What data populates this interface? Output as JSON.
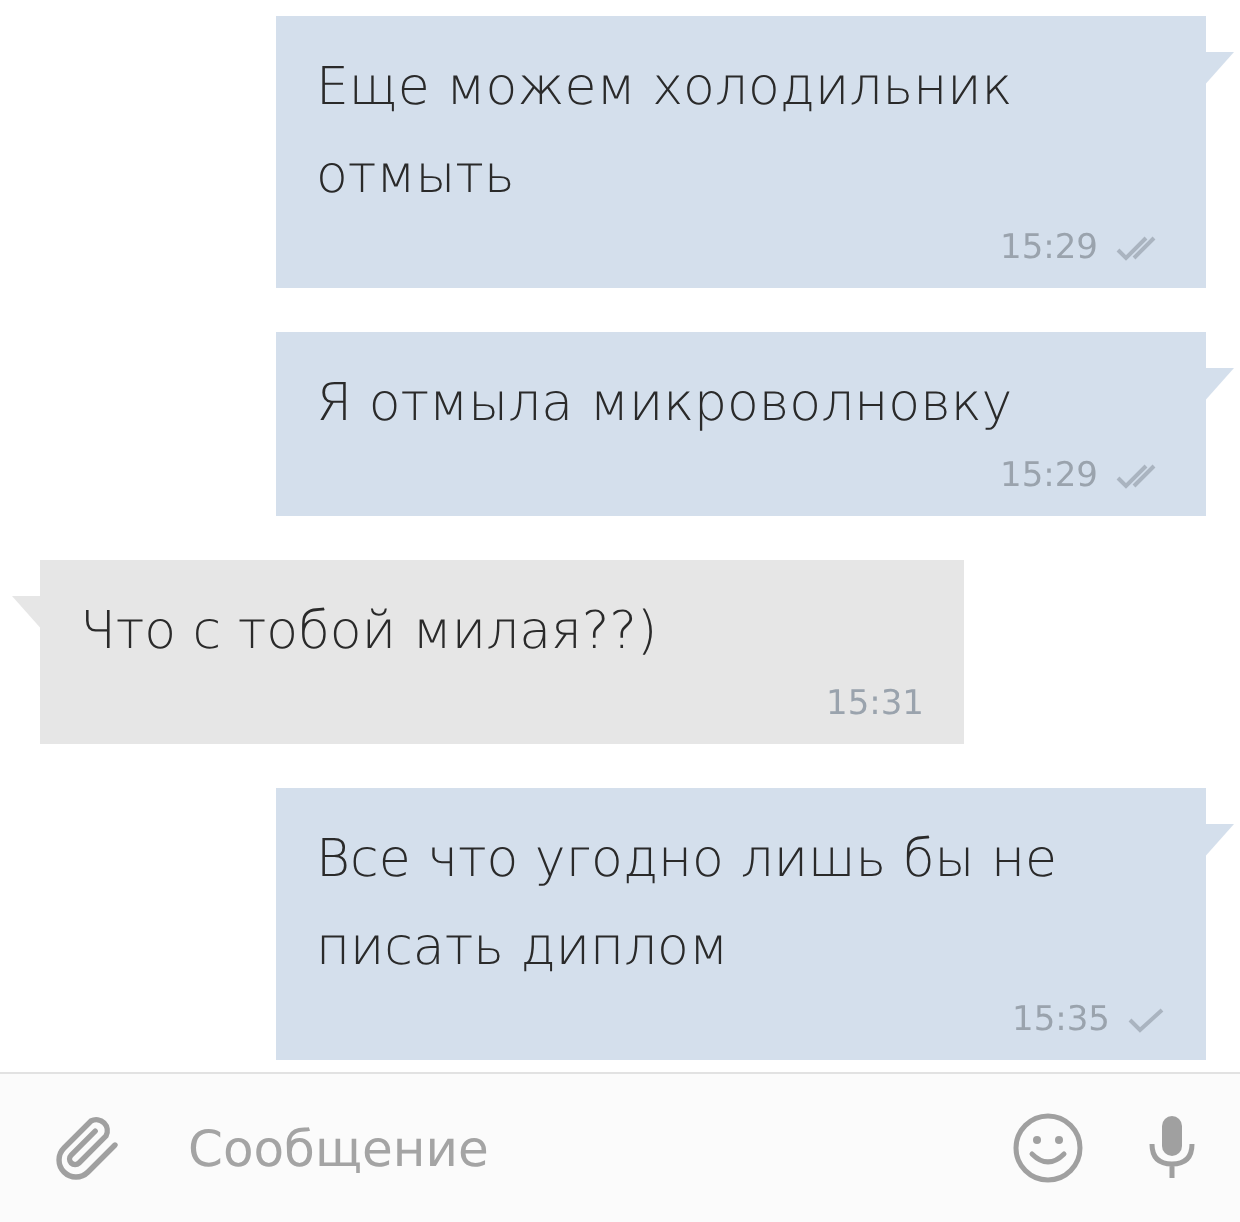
{
  "messages": [
    {
      "outgoing": true,
      "text": "Еще можем холодильник отмыть",
      "time": "15:29",
      "read": true
    },
    {
      "outgoing": true,
      "text": "Я отмыла микроволновку",
      "time": "15:29",
      "read": true
    },
    {
      "outgoing": false,
      "text": "Что с тобой милая??)",
      "time": "15:31"
    },
    {
      "outgoing": true,
      "text": "Все что угодно лишь бы не писать диплом",
      "time": "15:35",
      "read": false
    }
  ],
  "composer": {
    "placeholder": "Сообщение"
  }
}
